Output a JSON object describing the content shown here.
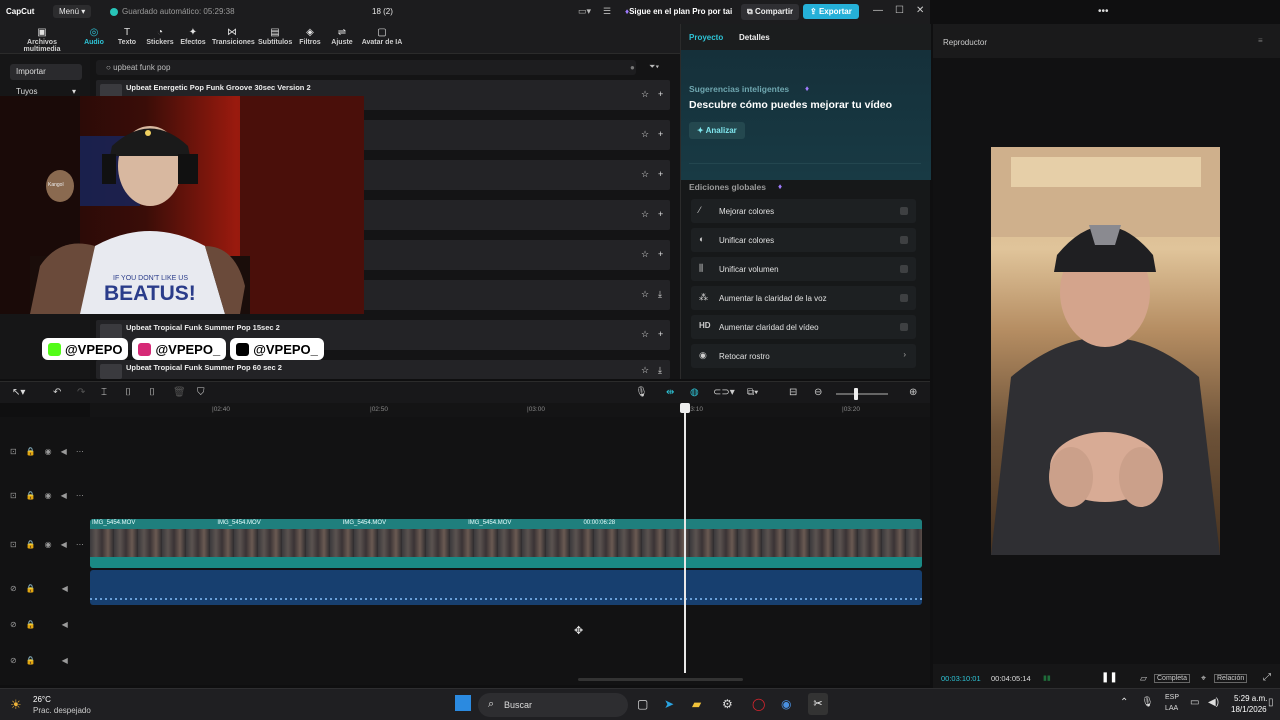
{
  "app": {
    "logo": "CapCut",
    "menu_label": "Menú",
    "autosave": "Guardado automático: 05:29:38",
    "project_name": "18 (2)",
    "pro_plan": "Sigue en el plan Pro por tai",
    "share_label": "Compartir",
    "export_label": "Exportar"
  },
  "toolbar": {
    "items": [
      {
        "label": "Archivos multimedia",
        "icon": "media-icon"
      },
      {
        "label": "Audio",
        "icon": "audio-icon"
      },
      {
        "label": "Texto",
        "icon": "text-icon"
      },
      {
        "label": "Stickers",
        "icon": "sticker-icon"
      },
      {
        "label": "Efectos",
        "icon": "effects-icon"
      },
      {
        "label": "Transiciones",
        "icon": "transitions-icon"
      },
      {
        "label": "Subtítulos",
        "icon": "subtitles-icon"
      },
      {
        "label": "Filtros",
        "icon": "filters-icon"
      },
      {
        "label": "Ajuste",
        "icon": "adjust-icon"
      },
      {
        "label": "Avatar de IA",
        "icon": "avatar-icon"
      }
    ],
    "active": "Audio"
  },
  "leftnav": {
    "import_label": "Importar",
    "yours_label": "Tuyos"
  },
  "media": {
    "search_value": "upbeat funk pop",
    "tracks": [
      {
        "title": "Upbeat Energetic Pop Funk Groove 30sec Version 2"
      },
      {
        "title": ""
      },
      {
        "title": ""
      },
      {
        "title": ""
      },
      {
        "title": ""
      },
      {
        "title": ""
      },
      {
        "title": "Upbeat Tropical Funk Summer Pop 15sec 2"
      },
      {
        "title": "Upbeat Tropical Funk Summer Pop 60 sec 2"
      }
    ]
  },
  "webcam": {
    "shirt_line1": "IF YOU DON'T LIKE US",
    "shirt_line2": "BEATUS!",
    "cap_label": "Kangol"
  },
  "socials": [
    {
      "handle": "@VPEPO",
      "icon": "kick-icon",
      "color": "#53fc18"
    },
    {
      "handle": "@VPEPO_",
      "icon": "instagram-icon",
      "color": "#d62976"
    },
    {
      "handle": "@VPEPO_",
      "icon": "tiktok-icon",
      "color": "#000000"
    }
  ],
  "right_panel": {
    "tab_project": "Proyecto",
    "tab_details": "Detalles",
    "smart_title": "Sugerencias inteligentes",
    "smart_subtitle": "Descubre cómo puedes mejorar tu vídeo",
    "analyze_label": "Analizar",
    "global_title": "Ediciones globales",
    "edits": [
      {
        "label": "Mejorar colores",
        "icon": "magic-wand-icon"
      },
      {
        "label": "Unificar colores",
        "icon": "color-match-icon"
      },
      {
        "label": "Unificar volumen",
        "icon": "volume-sliders-icon"
      },
      {
        "label": "Aumentar la claridad de la voz",
        "icon": "voice-icon"
      },
      {
        "label": "Aumentar claridad del vídeo",
        "icon": "hd-icon"
      },
      {
        "label": "Retocar rostro",
        "icon": "face-icon"
      }
    ]
  },
  "player": {
    "title": "Reproductor",
    "current_time": "00:03:10:01",
    "total_time": "00:04:05:14",
    "full_label": "Completa",
    "ratio_label": "Relación"
  },
  "timeline": {
    "ruler": [
      "|02:40",
      "|02:50",
      "|03:00",
      "|03:10",
      "|03:20"
    ],
    "clip_label": "IMG_5454.MOV",
    "clip_time": "00:00:06:28"
  },
  "taskbar": {
    "temp": "26°C",
    "weather": "Prac. despejado",
    "search": "Buscar",
    "lang": "ESP",
    "lang2": "LAA",
    "time": "5:29 a.m.",
    "date": "18/1/2026"
  },
  "colors": {
    "accent": "#2ec4d6",
    "export": "#25b0d8",
    "video_track": "#1b6e6e",
    "audio_track": "#173f6f"
  }
}
